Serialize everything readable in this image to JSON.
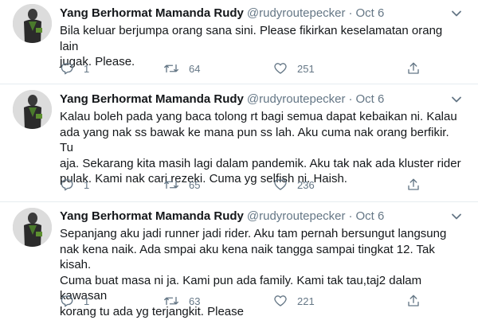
{
  "tweets": [
    {
      "name": "Yang Berhormat Mamanda Rudy",
      "handle": "@rudyroutepecker",
      "separator": "·",
      "date": "Oct 6",
      "text": "Bila keluar berjumpa orang sana sini. Please fikirkan keselamatan orang lain\njugak. Please.",
      "replies": "1",
      "retweets": "64",
      "likes": "251"
    },
    {
      "name": "Yang Berhormat Mamanda Rudy",
      "handle": "@rudyroutepecker",
      "separator": "·",
      "date": "Oct 6",
      "text": "Kalau boleh pada yang baca tolong rt bagi semua dapat kebaikan ni. Kalau\nada yang nak ss bawak ke mana pun ss lah. Aku cuma nak orang berfikir. Tu\naja. Sekarang kita masih lagi dalam pandemik. Aku tak nak ada kluster rider\npulak. Kami nak cari rezeki. Cuma yg selfish ni. Haish.",
      "replies": "1",
      "retweets": "65",
      "likes": "236"
    },
    {
      "name": "Yang Berhormat Mamanda Rudy",
      "handle": "@rudyroutepecker",
      "separator": "·",
      "date": "Oct 6",
      "text": "Sepanjang aku jadi runner jadi rider. Aku tam pernah bersungut langsung\nnak kena naik. Ada smpai aku kena naik tangga sampai tingkat 12. Tak kisah.\nCuma buat masa ni ja. Kami pun ada family. Kami tak tau,taj2 dalam kawasan\nkorang tu ada yg terjangkit. Please",
      "replies": "1",
      "retweets": "63",
      "likes": "221"
    }
  ],
  "icons": {
    "caret": "chevron-down-icon",
    "reply": "reply-icon",
    "retweet": "retweet-icon",
    "like": "heart-icon",
    "share": "share-icon"
  },
  "colors": {
    "text": "#14171a",
    "muted": "#657786",
    "divider": "#e6ecf0"
  }
}
